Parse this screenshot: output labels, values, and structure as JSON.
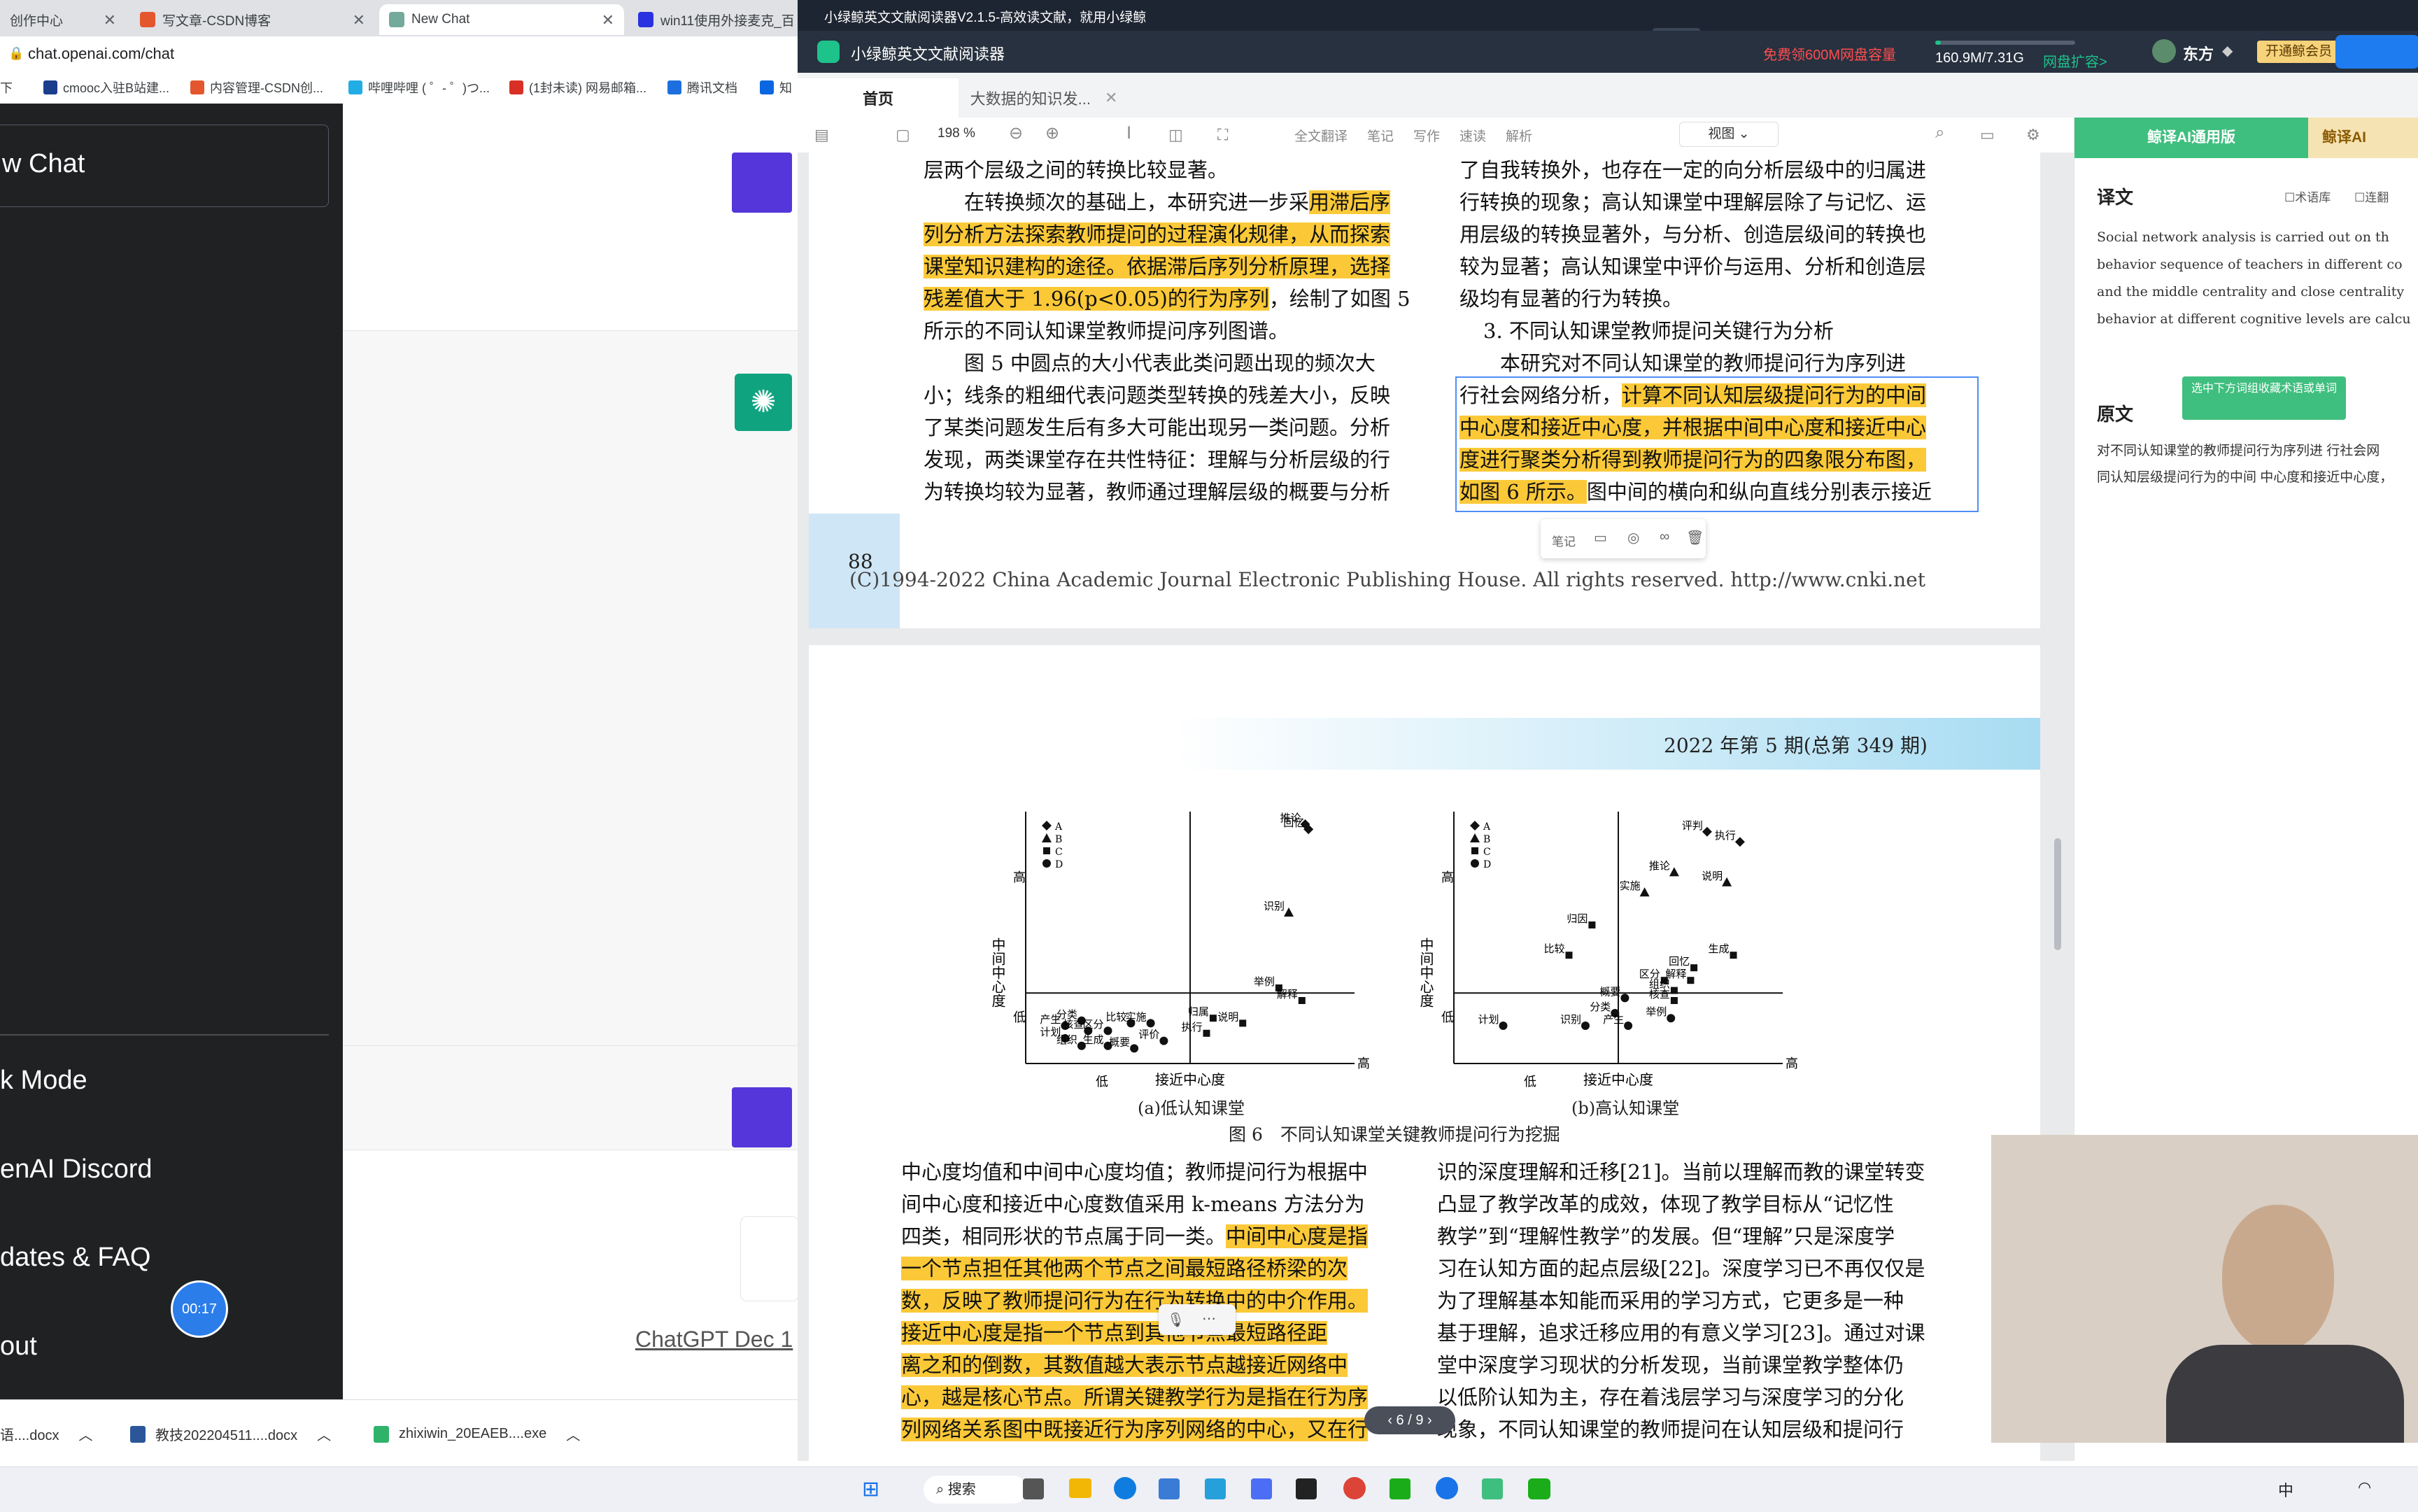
{
  "browser": {
    "tabs": [
      {
        "label": "创作中心"
      },
      {
        "label": "写文章-CSDN博客"
      },
      {
        "label": "New Chat"
      },
      {
        "label": "win11使用外接麦克_百..."
      }
    ],
    "url": "chat.openai.com/chat",
    "bookmarks": [
      "下",
      "cmooc入驻B站建...",
      "内容管理-CSDN创...",
      "哔哩哔哩 ( ゜- ゜)つ...",
      "(1封未读) 网易邮箱...",
      "腾讯文档",
      "知"
    ]
  },
  "chatgpt": {
    "new_chat": "w Chat",
    "sidebar_items": [
      "k Mode",
      "enAI Discord",
      "dates & FAQ",
      "out"
    ],
    "timer": "00:17",
    "footer_link": "ChatGPT Dec 1"
  },
  "downloads": [
    "语....docx",
    "教技202204511....docx",
    "zhixiwin_20EAEB....exe"
  ],
  "reader": {
    "window_title": "小绿鲸英文文献阅读器V2.1.5-高效读文献，就用小绿鲸",
    "app_name": "小绿鲸英文文献阅读器",
    "promo": "免费领600M网盘容量",
    "storage": "160.9M/7.31G",
    "expand": "网盘扩容>",
    "user": "东方",
    "vip": "开通鲸会员",
    "tabs": [
      "首页",
      "大数据的知识发..."
    ],
    "toolbar": {
      "zoom": "198 %",
      "items": [
        "全文翻译",
        "笔记",
        "写作",
        "速读",
        "解析"
      ],
      "view": "视图"
    },
    "page_indicator": "6 / 9",
    "page1": {
      "left_lines": [
        "层两个层级之间的转换比较显著。",
        "　　在转换频次的基础上，本研究进一步采",
        "用滞后序",
        "列分析方法探索教师提问的过程演化规律，从而探索",
        "课堂知识建构的途径。依据滞后序列分析原理，选择",
        "残差值大于 1.96(p<0.05)的行为序列",
        "，绘制了如图 5",
        "所示的不同认知课堂教师提问序列图谱。",
        "　　图 5 中圆点的大小代表此类问题出现的频次大",
        "小；线条的粗细代表问题类型转换的残差大小，反映",
        "了某类问题发生后有多大可能出现另一类问题。分析",
        "发现，两类课堂存在共性特征：理解与分析层级的行",
        "为转换均较为显著，教师通过理解层级的概要与分析"
      ],
      "right_lines": [
        "了自我转换外，也存在一定的向分析层级中的归属进",
        "行转换的现象；高认知课堂中理解层除了与记忆、运",
        "用层级的转换显著外，与分析、创造层级间的转换也",
        "较为显著；高认知课堂中评价与运用、分析和创造层",
        "级均有显著的行为转换。",
        "3. 不同认知课堂教师提问关键行为分析",
        "　　本研究对不同认知课堂的教师提问行为序列进",
        "行社会网络分析，",
        "计算不同认知层级提问行为的中间",
        "中心度和接近中心度，并根据中间中心度和接近中心",
        "度进行聚类分析得到教师提问行为的四象限分布图，",
        "如图 6 所示。",
        "图中间的横向和纵向直线分别表示接近"
      ],
      "page_no": "88",
      "copyright": "(C)1994-2022 China Academic Journal Electronic Publishing House. All rights reserved.    http://www.cnki.net",
      "popup": [
        "笔记"
      ]
    },
    "page2": {
      "header": "2022 年第 5 期(总第 349 期)",
      "chart_a_caption": "(a)低认知课堂",
      "chart_b_caption": "(b)高认知课堂",
      "figure_caption": "图 6　不同认知课堂关键教师提问行为挖掘",
      "axis_x": "接近中心度",
      "axis_y": "中间中心度",
      "high": "高",
      "low": "低",
      "legend": [
        "A",
        "B",
        "C",
        "D"
      ],
      "left_lines": [
        "中心度均值和中间中心度均值；教师提问行为根据中",
        "间中心度和接近中心度数值采用 k-means 方法分为",
        "四类，相同形状的节点属于同一类。",
        "中间中心度是指",
        "一个节点担任其他两个节点之间最短路径桥梁的次",
        "数，反映了教师提问行为在行为转换中的中介作用。",
        "接近中心度是指一个节点到其他节点最短路径距",
        "离之和的倒数，其数值越大表示节点越接近网络中",
        "心，越是核心节点。所谓关键教学行为是指在行为序",
        "列网络关系图中既接近行为序列网络的中心，又在行"
      ],
      "right_lines": [
        "识的深度理解和迁移[21]。当前以理解而教的课堂转变",
        "凸显了教学改革的成效，体现了教学目标从“记忆性",
        "教学”到“理解性教学”的发展。但“理解”只是深度学",
        "习在认知方面的起点层级[22]。深度学习已不再仅仅是",
        "为了理解基本知能而采用的学习方式，它更多是一种",
        "基于理解，追求迁移应用的有意义学习[23]。通过对课",
        "堂中深度学习现状的分析发现，当前课堂教学整体仍",
        "以低阶认知为主，存在着浅层学习与深度学习的分化",
        "现象，不同认知课堂的教师提问在认知层级和提问行"
      ]
    },
    "sidebar": {
      "tab1": "鲸译AI通用版",
      "tab2": "鲸译AI",
      "translation_title": "译文",
      "options": [
        "术语库",
        "连翻"
      ],
      "translation_text": [
        "Social network analysis is carried out on th",
        "behavior sequence of teachers in different co",
        "and the middle centrality and close centrality",
        "behavior at different cognitive levels are calcu"
      ],
      "tooltip": "选中下方词组收藏术语或单词",
      "original_title": "原文",
      "original_text": [
        "对不同认知课堂的教师提问行为序列进 行社会网",
        "同认知层级提问行为的中间 中心度和接近中心度，"
      ]
    }
  },
  "taskbar": {
    "search": "搜索",
    "ime": "中"
  },
  "chart_data": [
    {
      "type": "scatter",
      "title": "(a)低认知课堂",
      "xlabel": "接近中心度",
      "ylabel": "中间中心度",
      "series": [
        {
          "name": "A",
          "points": [
            {
              "label": "推论",
              "x": 0.85,
              "y": 0.95
            },
            {
              "label": "回忆",
              "x": 0.86,
              "y": 0.93
            }
          ]
        },
        {
          "name": "B",
          "points": [
            {
              "label": "识别",
              "x": 0.8,
              "y": 0.6
            }
          ]
        },
        {
          "name": "C",
          "points": [
            {
              "label": "举例",
              "x": 0.77,
              "y": 0.3
            },
            {
              "label": "解释",
              "x": 0.84,
              "y": 0.25
            },
            {
              "label": "归属",
              "x": 0.57,
              "y": 0.18
            },
            {
              "label": "说明",
              "x": 0.66,
              "y": 0.16
            },
            {
              "label": "执行",
              "x": 0.55,
              "y": 0.12
            }
          ]
        },
        {
          "name": "D",
          "points": [
            {
              "label": "产生",
              "x": 0.12,
              "y": 0.15
            },
            {
              "label": "计划",
              "x": 0.12,
              "y": 0.1
            },
            {
              "label": "分类",
              "x": 0.17,
              "y": 0.17
            },
            {
              "label": "核查",
              "x": 0.19,
              "y": 0.13
            },
            {
              "label": "组织",
              "x": 0.17,
              "y": 0.07
            },
            {
              "label": "区分",
              "x": 0.25,
              "y": 0.13
            },
            {
              "label": "生成",
              "x": 0.25,
              "y": 0.07
            },
            {
              "label": "比较",
              "x": 0.32,
              "y": 0.16
            },
            {
              "label": "实施",
              "x": 0.38,
              "y": 0.16
            },
            {
              "label": "概要",
              "x": 0.33,
              "y": 0.06
            },
            {
              "label": "评价",
              "x": 0.42,
              "y": 0.09
            }
          ]
        }
      ]
    },
    {
      "type": "scatter",
      "title": "(b)高认知课堂",
      "xlabel": "接近中心度",
      "ylabel": "中间中心度",
      "series": [
        {
          "name": "A",
          "points": [
            {
              "label": "评判",
              "x": 0.77,
              "y": 0.92
            },
            {
              "label": "执行",
              "x": 0.87,
              "y": 0.88
            }
          ]
        },
        {
          "name": "B",
          "points": [
            {
              "label": "推论",
              "x": 0.67,
              "y": 0.76
            },
            {
              "label": "实施",
              "x": 0.58,
              "y": 0.68
            },
            {
              "label": "说明",
              "x": 0.83,
              "y": 0.72
            }
          ]
        },
        {
          "name": "C",
          "points": [
            {
              "label": "归因",
              "x": 0.42,
              "y": 0.55
            },
            {
              "label": "比较",
              "x": 0.35,
              "y": 0.43
            },
            {
              "label": "生成",
              "x": 0.85,
              "y": 0.43
            },
            {
              "label": "回忆",
              "x": 0.73,
              "y": 0.38
            },
            {
              "label": "解释",
              "x": 0.72,
              "y": 0.33
            },
            {
              "label": "区分",
              "x": 0.64,
              "y": 0.33
            },
            {
              "label": "组织",
              "x": 0.67,
              "y": 0.29
            },
            {
              "label": "核查",
              "x": 0.67,
              "y": 0.25
            }
          ]
        },
        {
          "name": "D",
          "points": [
            {
              "label": "概要",
              "x": 0.52,
              "y": 0.26
            },
            {
              "label": "分类",
              "x": 0.49,
              "y": 0.2
            },
            {
              "label": "产生",
              "x": 0.53,
              "y": 0.15
            },
            {
              "label": "举例",
              "x": 0.66,
              "y": 0.18
            },
            {
              "label": "识别",
              "x": 0.4,
              "y": 0.15
            },
            {
              "label": "计划",
              "x": 0.15,
              "y": 0.15
            }
          ]
        }
      ]
    }
  ]
}
